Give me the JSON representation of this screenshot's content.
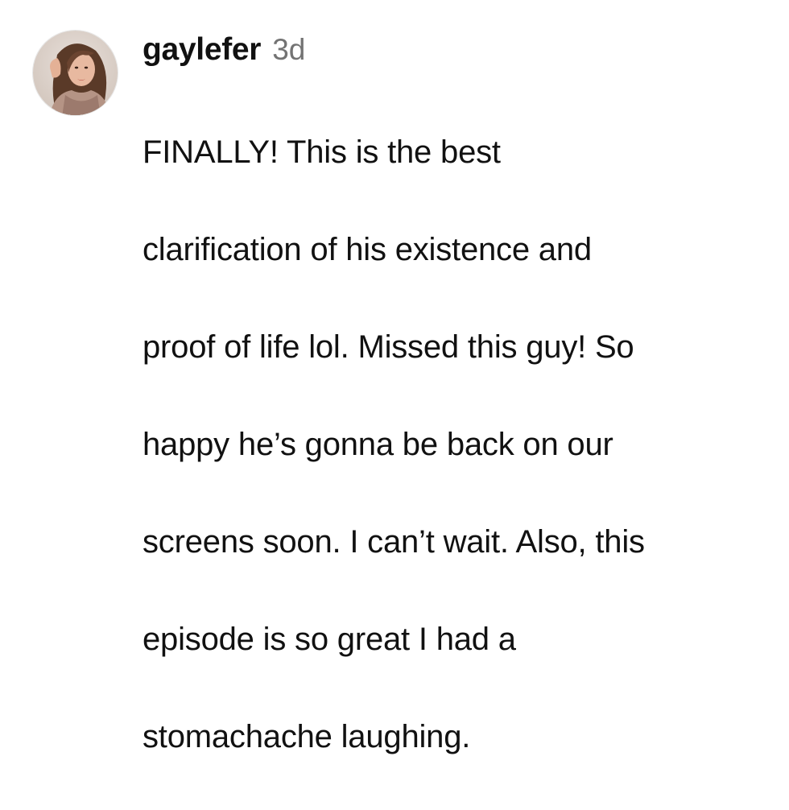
{
  "comment": {
    "username": "gaylefer",
    "timestamp": "3d",
    "lines": [
      "FINALLY! This is the best",
      "clarification of his existence and",
      "proof of life lol. Missed this guy! So",
      "happy he’s gonna be back on our",
      "screens soon. I can’t wait. Also, this",
      "episode is so great I had a",
      "stomachache laughing."
    ],
    "avatar_icon": "profile-photo"
  }
}
